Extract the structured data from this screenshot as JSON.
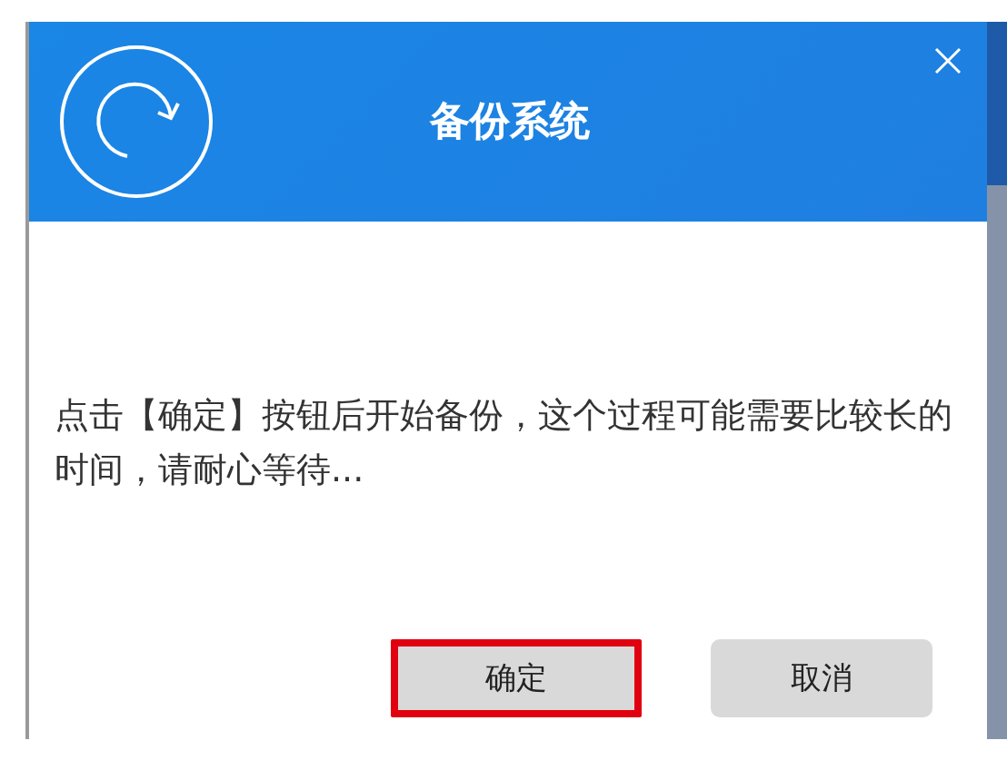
{
  "dialog": {
    "title": "备份系统",
    "message": "点击【确定】按钮后开始备份，这个过程可能需要比较长的时间，请耐心等待...",
    "buttons": [
      {
        "label": "确定",
        "highlighted": true
      },
      {
        "label": "取消",
        "highlighted": false
      }
    ]
  }
}
